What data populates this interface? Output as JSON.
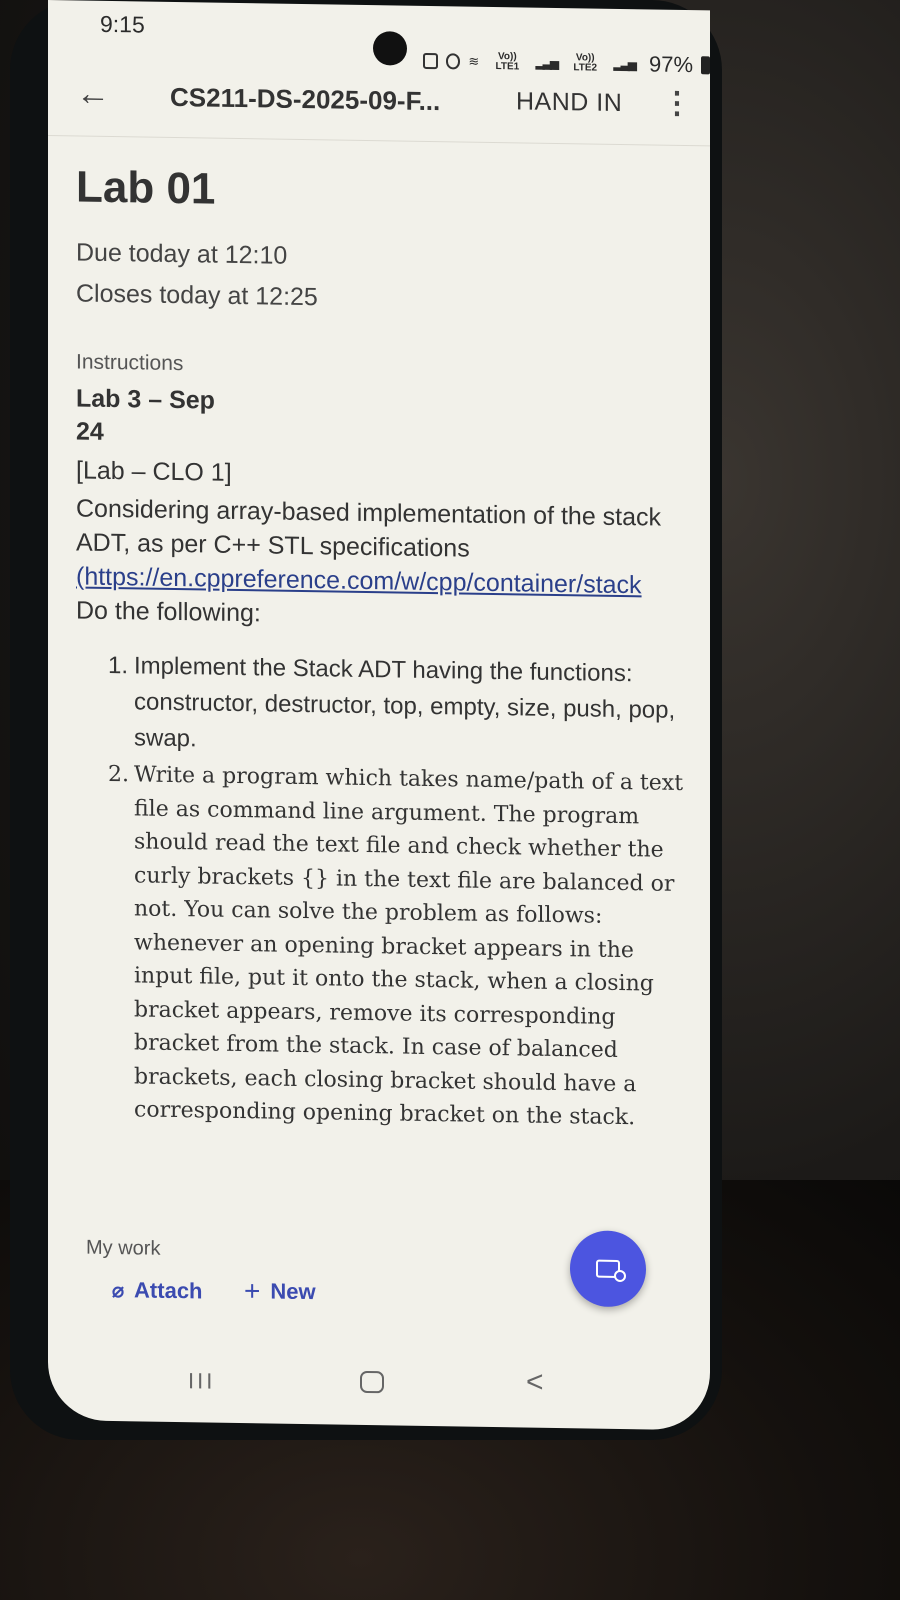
{
  "status_bar": {
    "time": "9:15",
    "sim1": "Vo)) LTE1",
    "sim2": "Vo)) LTE2",
    "battery": "97%"
  },
  "app_bar": {
    "title": "CS211-DS-2025-09-F...",
    "action": "HAND IN"
  },
  "assignment": {
    "title": "Lab 01",
    "due": "Due today at 12:10",
    "closes": "Closes today at 12:25"
  },
  "instructions": {
    "label": "Instructions",
    "heading_line1": "Lab 3 – Sep",
    "heading_line2": "24",
    "tag": "[Lab – CLO 1]",
    "intro": "Considering array-based implementation of the stack ADT, as per C++ STL specifications",
    "link": "(https://en.cppreference.com/w/cpp/container/stack",
    "do_following": "Do the following:",
    "tasks": [
      {
        "num": "1.",
        "text": "Implement the Stack ADT having the functions: constructor, destructor, top, empty, size, push, pop, swap."
      },
      {
        "num": "2.",
        "text": "Write a program which takes name/path of a text file as command line argument. The program should read the text file and check whether the curly brackets {} in the text file are balanced or not. You can solve the problem as follows: whenever an opening bracket appears in the input file, put it onto the stack, when a closing bracket appears, remove its corresponding bracket from the stack. In case of balanced brackets, each closing bracket should have a corresponding opening bracket on the stack."
      }
    ]
  },
  "my_work": {
    "label": "My work",
    "attach_label": "Attach",
    "new_label": "New"
  },
  "icons": {
    "back": "arrow-left-icon",
    "more": "more-vert-icon",
    "attach": "paperclip-icon",
    "new": "plus-icon",
    "fab": "immersive-reader-icon"
  },
  "colors": {
    "accent": "#3b4bb0",
    "fab": "#4c55e0",
    "link": "#2a3f8a",
    "background": "#f2f1ea"
  }
}
